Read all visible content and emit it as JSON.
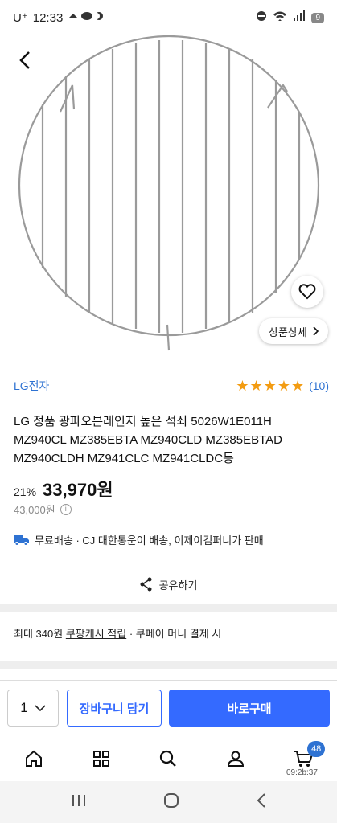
{
  "status_bar": {
    "carrier": "U⁺",
    "time": "12:33",
    "battery": "9"
  },
  "product": {
    "brand": "LG전자",
    "rating": 5,
    "review_count": "(10)",
    "title": "LG 정품 광파오븐레인지 높은 석쇠 5026W1E011H MZ940CL MZ385EBTA MZ940CLD MZ385EBTAD MZ940CLDH MZ941CLC MZ941CLDC등",
    "discount": "21%",
    "price": "33,970원",
    "original_price": "43,000원",
    "shipping": "무료배송 · CJ 대한통운이 배송, 이제이컴퍼니가 판매",
    "detail_button": "상품상세"
  },
  "share": {
    "label": "공유하기"
  },
  "cash": {
    "prefix": "최대 340원",
    "link": "쿠팡캐시 적립",
    "suffix": "· 쿠페이 머니 결제 시"
  },
  "buy_bar": {
    "quantity": "1",
    "cart_label": "장바구니 담기",
    "buy_label": "바로구매"
  },
  "tab_bar": {
    "cart_badge": "48",
    "clock": "09:2b:37"
  },
  "colors": {
    "accent": "#346aff",
    "brand_text": "#2e72d2",
    "star": "#f39c12"
  }
}
